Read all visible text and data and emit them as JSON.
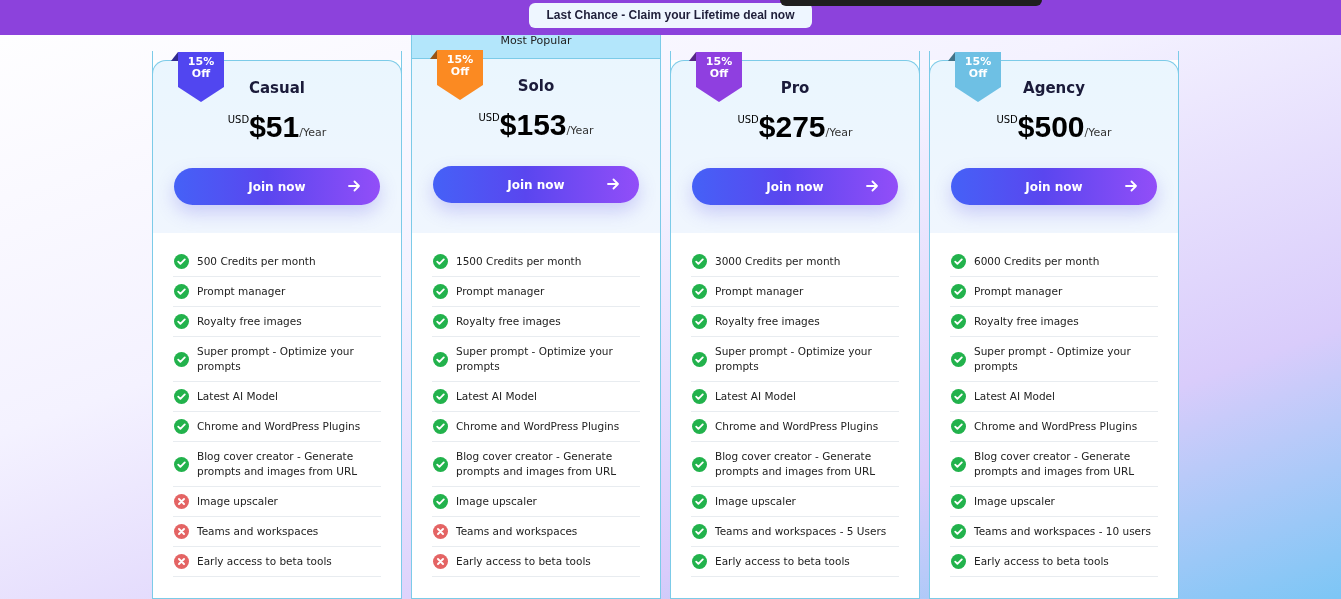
{
  "banner": {
    "text": "Last Chance - Claim your Lifetime deal now"
  },
  "plans": [
    {
      "name": "Casual",
      "badge": "15% Off",
      "color": "#5146f0",
      "currency": "USD",
      "price": "$51",
      "period": "/Year",
      "button": "Join now",
      "features": [
        {
          "text": "500 Credits per month",
          "included": true
        },
        {
          "text": "Prompt manager",
          "included": true
        },
        {
          "text": "Royalty free images",
          "included": true
        },
        {
          "text": "Super prompt - Optimize your prompts",
          "included": true
        },
        {
          "text": "Latest AI Model",
          "included": true
        },
        {
          "text": "Chrome and WordPress Plugins",
          "included": true
        },
        {
          "text": "Blog cover creator - Generate prompts and images from URL",
          "included": true
        },
        {
          "text": "Image upscaler",
          "included": false
        },
        {
          "text": "Teams and workspaces",
          "included": false
        },
        {
          "text": "Early access to beta tools",
          "included": false
        }
      ]
    },
    {
      "name": "Solo",
      "popular_label": "Most Popular",
      "badge": "15% Off",
      "color": "#fb8a22",
      "currency": "USD",
      "price": "$153",
      "period": "/Year",
      "button": "Join now",
      "features": [
        {
          "text": "1500 Credits per month",
          "included": true
        },
        {
          "text": "Prompt manager",
          "included": true
        },
        {
          "text": "Royalty free images",
          "included": true
        },
        {
          "text": "Super prompt - Optimize your prompts",
          "included": true
        },
        {
          "text": "Latest AI Model",
          "included": true
        },
        {
          "text": "Chrome and WordPress Plugins",
          "included": true
        },
        {
          "text": "Blog cover creator - Generate prompts and images from URL",
          "included": true
        },
        {
          "text": "Image upscaler",
          "included": true
        },
        {
          "text": "Teams and workspaces",
          "included": false
        },
        {
          "text": "Early access to beta tools",
          "included": false
        }
      ]
    },
    {
      "name": "Pro",
      "badge": "15% Off",
      "color": "#8f3fe0",
      "currency": "USD",
      "price": "$275",
      "period": "/Year",
      "button": "Join now",
      "features": [
        {
          "text": "3000 Credits per month",
          "included": true
        },
        {
          "text": "Prompt manager",
          "included": true
        },
        {
          "text": "Royalty free images",
          "included": true
        },
        {
          "text": "Super prompt - Optimize your prompts",
          "included": true
        },
        {
          "text": "Latest AI Model",
          "included": true
        },
        {
          "text": "Chrome and WordPress Plugins",
          "included": true
        },
        {
          "text": "Blog cover creator - Generate prompts and images from URL",
          "included": true
        },
        {
          "text": "Image upscaler",
          "included": true
        },
        {
          "text": "Teams and workspaces - 5 Users",
          "included": true
        },
        {
          "text": "Early access to beta tools",
          "included": true
        }
      ]
    },
    {
      "name": "Agency",
      "badge": "15% Off",
      "color": "#6ec0e4",
      "currency": "USD",
      "price": "$500",
      "period": "/Year",
      "button": "Join now",
      "features": [
        {
          "text": "6000 Credits per month",
          "included": true
        },
        {
          "text": "Prompt manager",
          "included": true
        },
        {
          "text": "Royalty free images",
          "included": true
        },
        {
          "text": "Super prompt - Optimize your prompts",
          "included": true
        },
        {
          "text": "Latest AI Model",
          "included": true
        },
        {
          "text": "Chrome and WordPress Plugins",
          "included": true
        },
        {
          "text": "Blog cover creator - Generate prompts and images from URL",
          "included": true
        },
        {
          "text": "Image upscaler",
          "included": true
        },
        {
          "text": "Teams and workspaces - 10 users",
          "included": true
        },
        {
          "text": "Early access to beta tools",
          "included": true
        }
      ]
    }
  ]
}
